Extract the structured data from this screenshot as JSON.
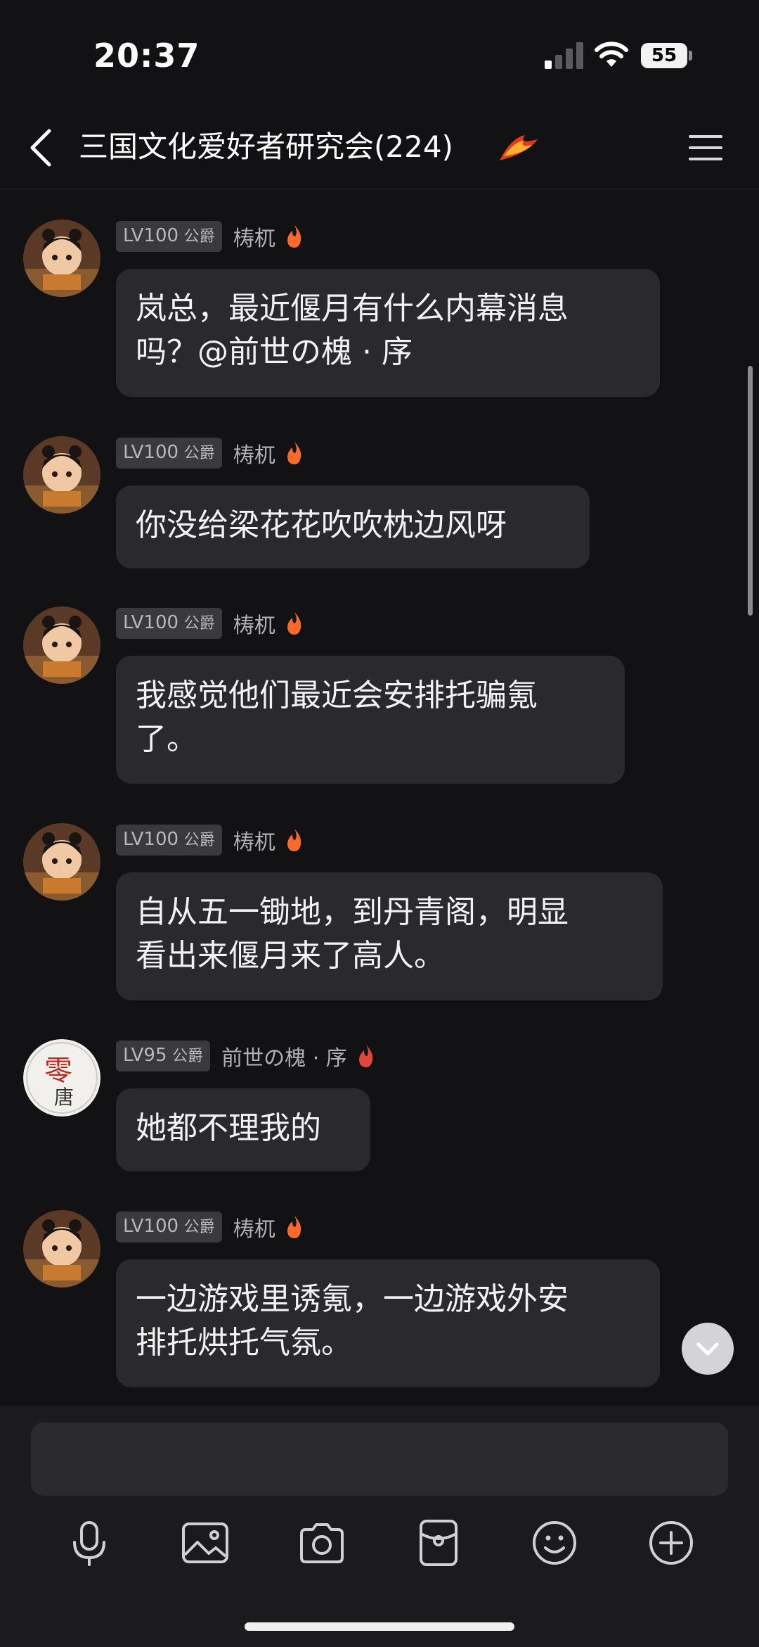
{
  "status_bar": {
    "time": "20:37",
    "battery": "55"
  },
  "header": {
    "title": "三国文化爱好者研究会(224)"
  },
  "messages": [
    {
      "level": "LV100",
      "rank": "公爵",
      "user": "梼杌",
      "lines": [
        "岚总，最近偃月有什么内幕消息",
        "吗？@前世の槐 · 序"
      ]
    },
    {
      "level": "LV100",
      "rank": "公爵",
      "user": "梼杌",
      "lines": [
        "你没给梁花花吹吹枕边风呀"
      ]
    },
    {
      "level": "LV100",
      "rank": "公爵",
      "user": "梼杌",
      "lines": [
        "我感觉他们最近会安排托骗氪",
        "了。"
      ]
    },
    {
      "level": "LV100",
      "rank": "公爵",
      "user": "梼杌",
      "lines": [
        "自从五一锄地，到丹青阁，明显",
        "看出来偃月来了高人。"
      ]
    },
    {
      "level": "LV95",
      "rank": "公爵",
      "user": "前世の槐 · 序",
      "lines": [
        "她都不理我的"
      ]
    },
    {
      "level": "LV100",
      "rank": "公爵",
      "user": "梼杌",
      "lines": [
        "一边游戏里诱氪，一边游戏外安",
        "排托烘托气氛。"
      ]
    }
  ],
  "colors": {
    "background": "#121214",
    "bubble": "#2a2a2e",
    "badge": "#3a3a3e",
    "fire": "#ff6a2b"
  },
  "icons": {
    "toolbar": [
      "microphone-icon",
      "image-icon",
      "camera-icon",
      "red-packet-icon",
      "emoji-icon",
      "plus-icon"
    ]
  }
}
